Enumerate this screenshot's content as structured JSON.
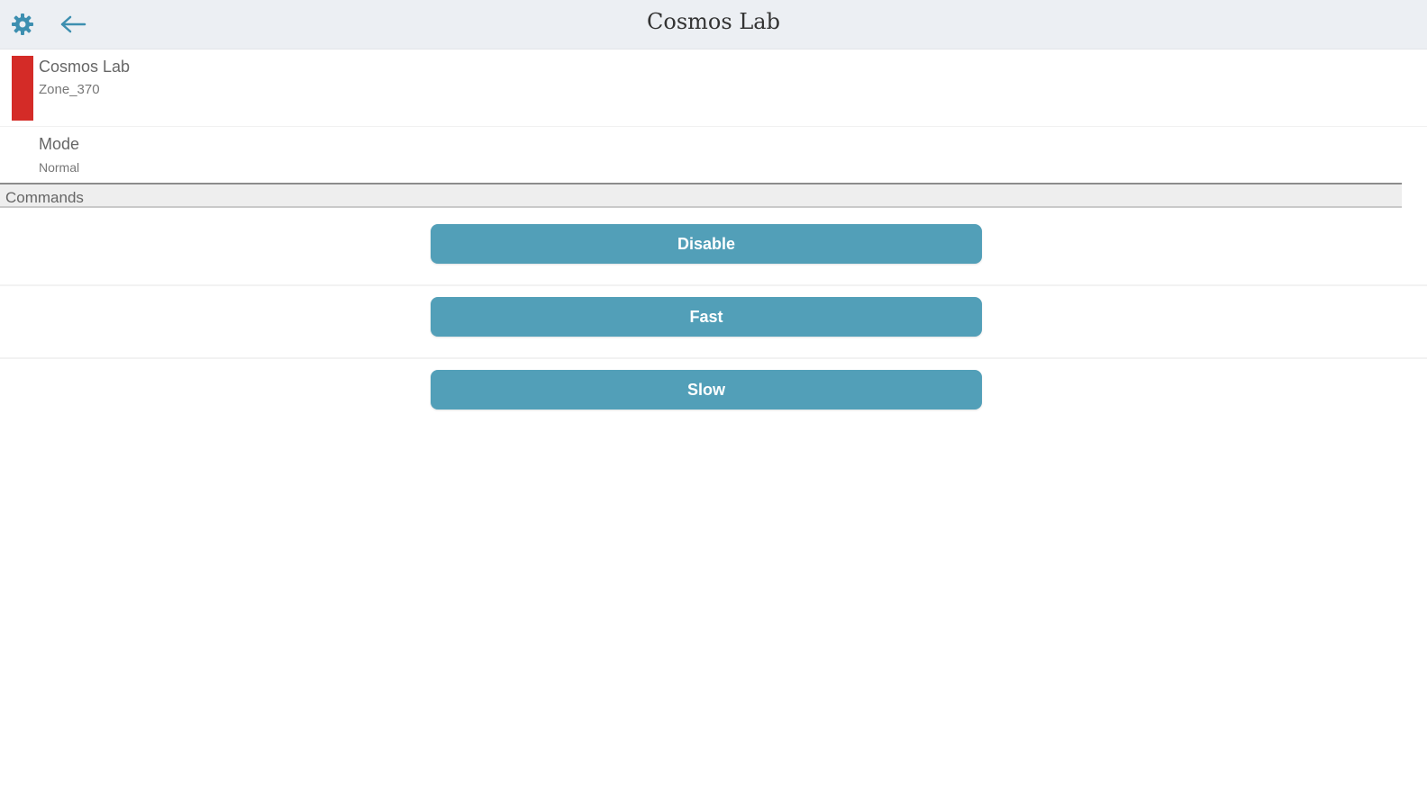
{
  "header": {
    "title": "Cosmos Lab",
    "settings_icon": "gear-icon",
    "back_icon": "arrow-left-icon"
  },
  "device": {
    "name": "Cosmos Lab",
    "zone": "Zone_370",
    "status_color": "#d42b27"
  },
  "mode": {
    "label": "Mode",
    "value": "Normal"
  },
  "commands": {
    "section_label": "Commands",
    "buttons": [
      {
        "label": "Disable"
      },
      {
        "label": "Fast"
      },
      {
        "label": "Slow"
      }
    ],
    "button_color": "#529fb8"
  }
}
